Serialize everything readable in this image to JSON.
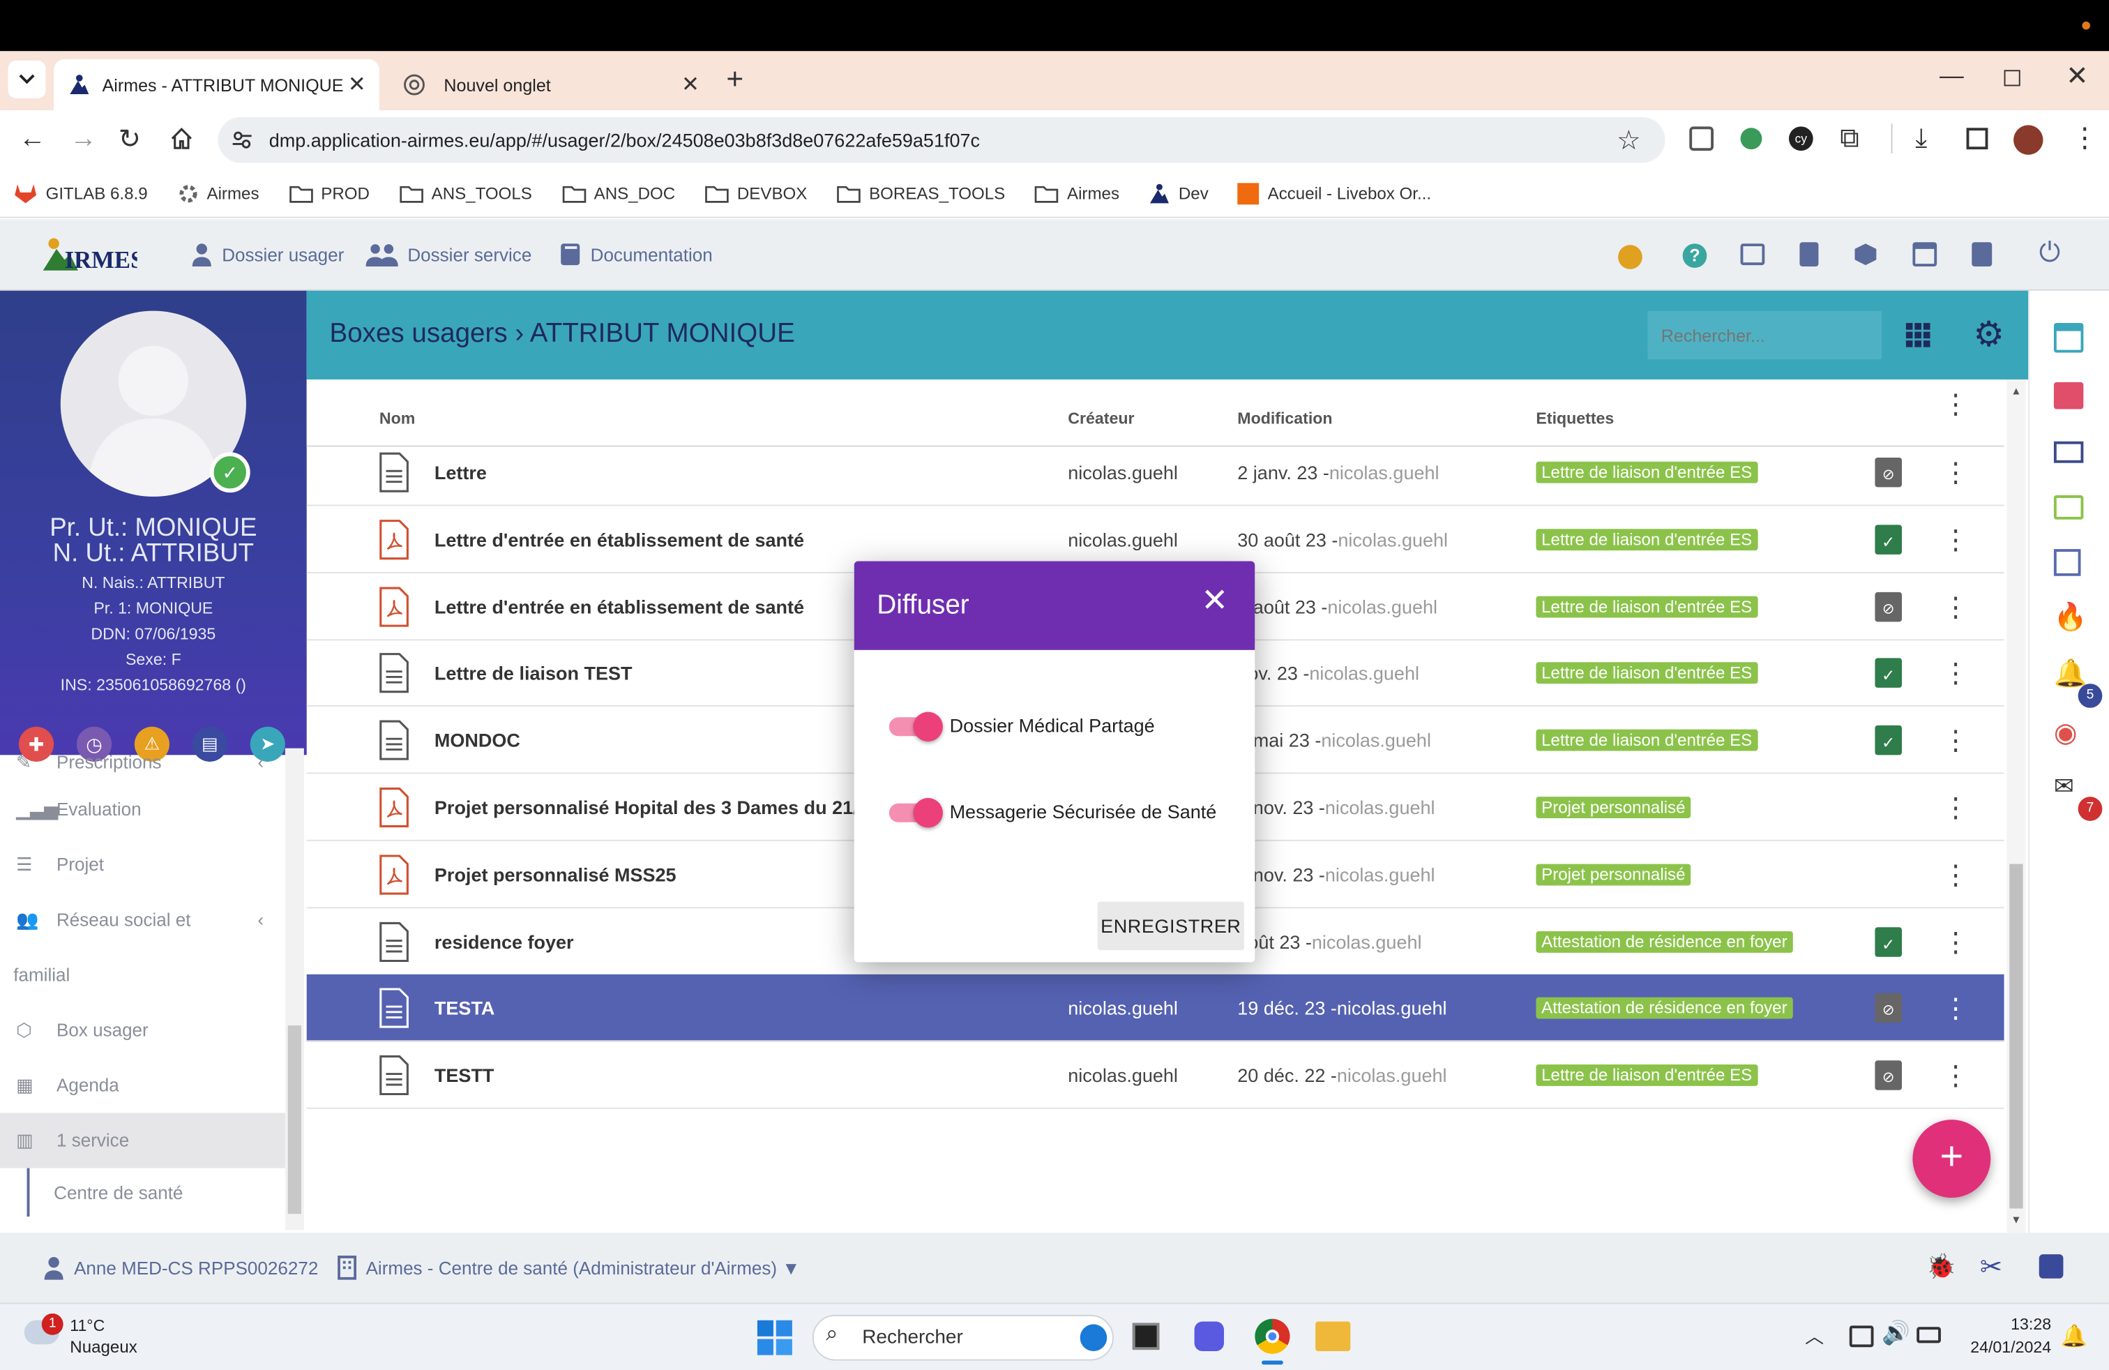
{
  "browser": {
    "tabs": [
      {
        "title": "Airmes - ATTRIBUT MONIQUE",
        "active": true
      },
      {
        "title": "Nouvel onglet",
        "active": false
      }
    ],
    "url": "dmp.application-airmes.eu/app/#/usager/2/box/24508e03b8f3d8e07622afe59a51f07c",
    "bookmarks": [
      "GITLAB 6.8.9",
      "Airmes",
      "PROD",
      "ANS_TOOLS",
      "ANS_DOC",
      "DEVBOX",
      "BOREAS_TOOLS",
      "Airmes",
      "Dev",
      "Accueil - Livebox Or..."
    ]
  },
  "app": {
    "logo": "AIRMES",
    "nav": {
      "dossier_usager": "Dossier usager",
      "dossier_service": "Dossier service",
      "documentation": "Documentation"
    }
  },
  "profile": {
    "line1": "Pr. Ut.: MONIQUE",
    "line2": "N. Ut.: ATTRIBUT",
    "nais": "N. Nais.: ATTRIBUT",
    "pr1": "Pr. 1: MONIQUE",
    "ddn": "DDN: 07/06/1935",
    "sexe": "Sexe: F",
    "ins": "INS: 235061058692768 ()"
  },
  "sidebar_menu": {
    "prescriptions": "Prescriptions",
    "evaluation": "Evaluation",
    "projet": "Projet",
    "reseau": "Réseau social et",
    "reseau2": "familial",
    "box": "Box usager",
    "agenda": "Agenda",
    "service": "1 service",
    "centre": "Centre de santé"
  },
  "main": {
    "breadcrumb": "Boxes usagers › ATTRIBUT MONIQUE",
    "search_placeholder": "Rechercher...",
    "columns": {
      "nom": "Nom",
      "createur": "Créateur",
      "modification": "Modification",
      "etiquettes": "Etiquettes"
    },
    "rows": [
      {
        "name": "Lettre",
        "creator": "nicolas.guehl",
        "date": "2 janv. 23 - ",
        "by": "nicolas.guehl",
        "tag": "Lettre de liaison d'entrée ES",
        "icon": "doc",
        "dmp": "grey"
      },
      {
        "name": "Lettre d'entrée en établissement de santé",
        "creator": "nicolas.guehl",
        "date": "30 août 23 - ",
        "by": "nicolas.guehl",
        "tag": "Lettre de liaison d'entrée ES",
        "icon": "pdf",
        "dmp": "green"
      },
      {
        "name": "Lettre d'entrée en établissement de santé",
        "creator": "",
        "date": "9 août 23 - ",
        "by": "nicolas.guehl",
        "tag": "Lettre de liaison d'entrée ES",
        "icon": "pdf",
        "dmp": "grey"
      },
      {
        "name": "Lettre de liaison TEST",
        "creator": "",
        "date": "nov. 23 - ",
        "by": "nicolas.guehl",
        "tag": "Lettre de liaison d'entrée ES",
        "icon": "doc",
        "dmp": "green"
      },
      {
        "name": "MONDOC",
        "creator": "",
        "date": "0 mai 23 - ",
        "by": "nicolas.guehl",
        "tag": "Lettre de liaison d'entrée ES",
        "icon": "doc",
        "dmp": "green"
      },
      {
        "name": "Projet personnalisé Hopital des 3 Dames du 21/",
        "creator": "",
        "date": "2 nov. 23 - ",
        "by": "nicolas.guehl",
        "tag": "Projet personnalisé",
        "icon": "pdf",
        "dmp": ""
      },
      {
        "name": "Projet personnalisé MSS25",
        "creator": "",
        "date": "2 nov. 23 - ",
        "by": "nicolas.guehl",
        "tag": "Projet personnalisé",
        "icon": "pdf",
        "dmp": ""
      },
      {
        "name": "residence foyer",
        "creator": "",
        "date": "août 23 - ",
        "by": "nicolas.guehl",
        "tag": "Attestation de résidence en foyer",
        "icon": "doc",
        "dmp": "green"
      },
      {
        "name": "TESTA",
        "creator": "nicolas.guehl",
        "date": "19 déc. 23 - ",
        "by": "nicolas.guehl",
        "tag": "Attestation de résidence en foyer",
        "icon": "doc",
        "dmp": "grey",
        "selected": true
      },
      {
        "name": "TESTT",
        "creator": "nicolas.guehl",
        "date": "20 déc. 22 - ",
        "by": "nicolas.guehl",
        "tag": "Lettre de liaison d'entrée ES",
        "icon": "doc",
        "dmp": "grey"
      }
    ]
  },
  "rail_badges": {
    "bell": "5",
    "other": "7"
  },
  "footer": {
    "user": "Anne MED-CS RPPS0026272",
    "org": "Airmes - Centre de santé (Administrateur d'Airmes) ▼"
  },
  "dialog": {
    "title": "Diffuser",
    "option1": "Dossier Médical Partagé",
    "option2": "Messagerie Sécurisée de Santé",
    "option1_on": true,
    "option2_on": true,
    "save": "ENREGISTRER"
  },
  "taskbar": {
    "weather_badge": "1",
    "temp": "11°C",
    "weather": "Nuageux",
    "search": "Rechercher",
    "time": "13:28",
    "date": "24/01/2024"
  },
  "colors": {
    "header_teal": "#3aa6ba",
    "dialog_purple": "#6f2eb0",
    "switch_pink": "#ec407a",
    "tag_green": "#8bc34a",
    "selected_row": "#5562b2"
  }
}
